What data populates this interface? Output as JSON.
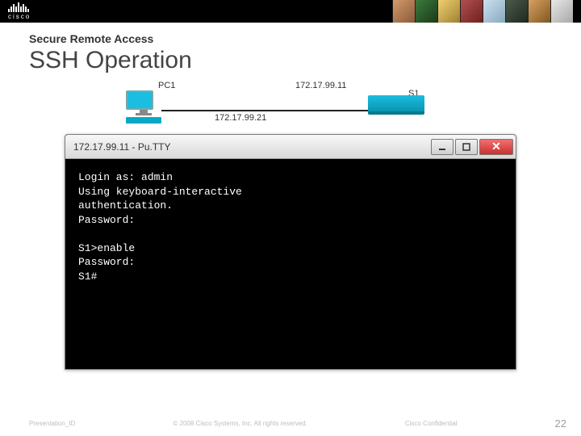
{
  "header": {
    "logo_text": "cisco"
  },
  "slide": {
    "pretitle": "Secure Remote Access",
    "title": "SSH Operation"
  },
  "diagram": {
    "pc_label": "PC1",
    "switch_label": "S1",
    "ip_switch": "172.17.99.11",
    "ip_pc": "172.17.99.21"
  },
  "window": {
    "title": "172.17.99.11 - Pu.TTY"
  },
  "terminal": {
    "lines": "Login as: admin\nUsing keyboard-interactive\nauthentication.\nPassword:\n\nS1>enable\nPassword:\nS1#"
  },
  "footer": {
    "left": "Presentation_ID",
    "center": "© 2008 Cisco Systems, Inc. All rights reserved.",
    "right": "Cisco Confidential",
    "page": "22"
  }
}
